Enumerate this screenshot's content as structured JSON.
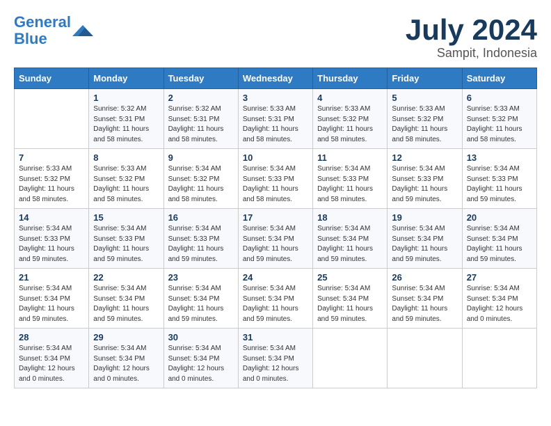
{
  "header": {
    "logo_line1": "General",
    "logo_line2": "Blue",
    "main_title": "July 2024",
    "subtitle": "Sampit, Indonesia"
  },
  "calendar": {
    "days_of_week": [
      "Sunday",
      "Monday",
      "Tuesday",
      "Wednesday",
      "Thursday",
      "Friday",
      "Saturday"
    ],
    "weeks": [
      [
        {
          "date": "",
          "info": ""
        },
        {
          "date": "1",
          "info": "Sunrise: 5:32 AM\nSunset: 5:31 PM\nDaylight: 11 hours and 58 minutes."
        },
        {
          "date": "2",
          "info": "Sunrise: 5:32 AM\nSunset: 5:31 PM\nDaylight: 11 hours and 58 minutes."
        },
        {
          "date": "3",
          "info": "Sunrise: 5:33 AM\nSunset: 5:31 PM\nDaylight: 11 hours and 58 minutes."
        },
        {
          "date": "4",
          "info": "Sunrise: 5:33 AM\nSunset: 5:32 PM\nDaylight: 11 hours and 58 minutes."
        },
        {
          "date": "5",
          "info": "Sunrise: 5:33 AM\nSunset: 5:32 PM\nDaylight: 11 hours and 58 minutes."
        },
        {
          "date": "6",
          "info": "Sunrise: 5:33 AM\nSunset: 5:32 PM\nDaylight: 11 hours and 58 minutes."
        }
      ],
      [
        {
          "date": "7",
          "info": "Sunrise: 5:33 AM\nSunset: 5:32 PM\nDaylight: 11 hours and 58 minutes."
        },
        {
          "date": "8",
          "info": "Sunrise: 5:33 AM\nSunset: 5:32 PM\nDaylight: 11 hours and 58 minutes."
        },
        {
          "date": "9",
          "info": "Sunrise: 5:34 AM\nSunset: 5:32 PM\nDaylight: 11 hours and 58 minutes."
        },
        {
          "date": "10",
          "info": "Sunrise: 5:34 AM\nSunset: 5:33 PM\nDaylight: 11 hours and 58 minutes."
        },
        {
          "date": "11",
          "info": "Sunrise: 5:34 AM\nSunset: 5:33 PM\nDaylight: 11 hours and 58 minutes."
        },
        {
          "date": "12",
          "info": "Sunrise: 5:34 AM\nSunset: 5:33 PM\nDaylight: 11 hours and 59 minutes."
        },
        {
          "date": "13",
          "info": "Sunrise: 5:34 AM\nSunset: 5:33 PM\nDaylight: 11 hours and 59 minutes."
        }
      ],
      [
        {
          "date": "14",
          "info": "Sunrise: 5:34 AM\nSunset: 5:33 PM\nDaylight: 11 hours and 59 minutes."
        },
        {
          "date": "15",
          "info": "Sunrise: 5:34 AM\nSunset: 5:33 PM\nDaylight: 11 hours and 59 minutes."
        },
        {
          "date": "16",
          "info": "Sunrise: 5:34 AM\nSunset: 5:33 PM\nDaylight: 11 hours and 59 minutes."
        },
        {
          "date": "17",
          "info": "Sunrise: 5:34 AM\nSunset: 5:34 PM\nDaylight: 11 hours and 59 minutes."
        },
        {
          "date": "18",
          "info": "Sunrise: 5:34 AM\nSunset: 5:34 PM\nDaylight: 11 hours and 59 minutes."
        },
        {
          "date": "19",
          "info": "Sunrise: 5:34 AM\nSunset: 5:34 PM\nDaylight: 11 hours and 59 minutes."
        },
        {
          "date": "20",
          "info": "Sunrise: 5:34 AM\nSunset: 5:34 PM\nDaylight: 11 hours and 59 minutes."
        }
      ],
      [
        {
          "date": "21",
          "info": "Sunrise: 5:34 AM\nSunset: 5:34 PM\nDaylight: 11 hours and 59 minutes."
        },
        {
          "date": "22",
          "info": "Sunrise: 5:34 AM\nSunset: 5:34 PM\nDaylight: 11 hours and 59 minutes."
        },
        {
          "date": "23",
          "info": "Sunrise: 5:34 AM\nSunset: 5:34 PM\nDaylight: 11 hours and 59 minutes."
        },
        {
          "date": "24",
          "info": "Sunrise: 5:34 AM\nSunset: 5:34 PM\nDaylight: 11 hours and 59 minutes."
        },
        {
          "date": "25",
          "info": "Sunrise: 5:34 AM\nSunset: 5:34 PM\nDaylight: 11 hours and 59 minutes."
        },
        {
          "date": "26",
          "info": "Sunrise: 5:34 AM\nSunset: 5:34 PM\nDaylight: 11 hours and 59 minutes."
        },
        {
          "date": "27",
          "info": "Sunrise: 5:34 AM\nSunset: 5:34 PM\nDaylight: 12 hours and 0 minutes."
        }
      ],
      [
        {
          "date": "28",
          "info": "Sunrise: 5:34 AM\nSunset: 5:34 PM\nDaylight: 12 hours and 0 minutes."
        },
        {
          "date": "29",
          "info": "Sunrise: 5:34 AM\nSunset: 5:34 PM\nDaylight: 12 hours and 0 minutes."
        },
        {
          "date": "30",
          "info": "Sunrise: 5:34 AM\nSunset: 5:34 PM\nDaylight: 12 hours and 0 minutes."
        },
        {
          "date": "31",
          "info": "Sunrise: 5:34 AM\nSunset: 5:34 PM\nDaylight: 12 hours and 0 minutes."
        },
        {
          "date": "",
          "info": ""
        },
        {
          "date": "",
          "info": ""
        },
        {
          "date": "",
          "info": ""
        }
      ]
    ]
  }
}
